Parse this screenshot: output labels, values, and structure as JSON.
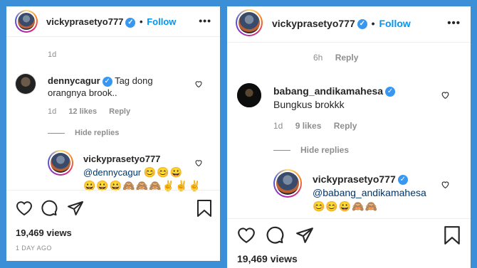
{
  "left": {
    "header": {
      "username": "vickyprasetyo777",
      "follow": "Follow",
      "separator": "•"
    },
    "prev_time": "1d",
    "comment": {
      "username": "dennycagur",
      "text_line1": "Tag dong",
      "text_line2": "orangnya brook..",
      "time": "1d",
      "likes": "12 likes",
      "reply": "Reply"
    },
    "hide_replies": "Hide replies",
    "reply": {
      "username": "vickyprasetyo777",
      "mention": "@dennycagur",
      "emoji_line1": "😊😊😀",
      "emoji_line2": "😀😀😀🙈🙈🙈✌✌✌"
    },
    "views": "19,469 views",
    "ago": "1 DAY AGO"
  },
  "right": {
    "header": {
      "username": "vickyprasetyo777",
      "follow": "Follow",
      "separator": "•"
    },
    "prev_time": "6h",
    "prev_reply": "Reply",
    "comment": {
      "username": "babang_andikamahesa",
      "text": "Bungkus brokkk",
      "time": "1d",
      "likes": "9 likes",
      "reply": "Reply"
    },
    "hide_replies": "Hide replies",
    "reply": {
      "username": "vickyprasetyo777",
      "mention": "@babang_andikamahesa",
      "emoji": "😊😊😀🙈🙈"
    },
    "views": "19,469 views"
  },
  "icons": {
    "heart": "heart-icon",
    "comment": "comment-icon",
    "share": "share-icon",
    "bookmark": "bookmark-icon",
    "more": "more-icon",
    "verified": "verified-icon"
  },
  "colors": {
    "background": "#3a8fd6",
    "follow": "#0095f6",
    "verified": "#3897f0",
    "mention": "#00376b",
    "muted": "#8e8e8e"
  }
}
